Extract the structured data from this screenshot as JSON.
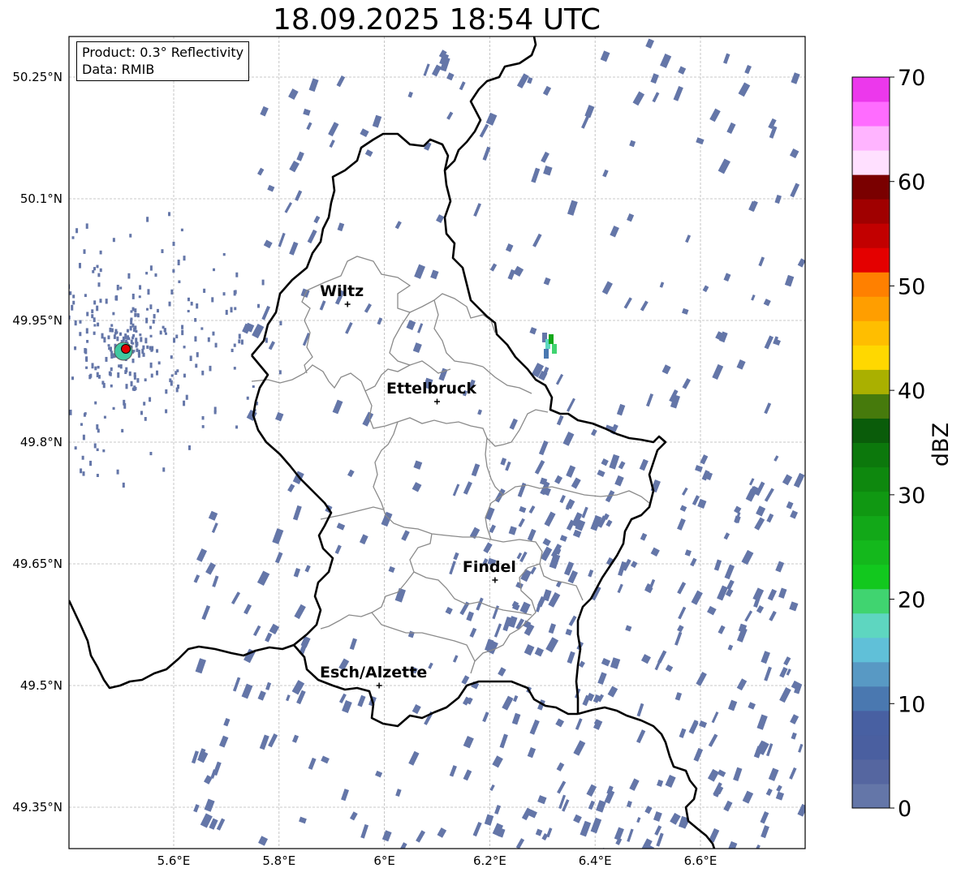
{
  "title": "18.09.2025 18:54 UTC",
  "infobox": {
    "product": "Product: 0.3° Reflectivity",
    "data": "Data: RMIB"
  },
  "map": {
    "lon_range": [
      5.4,
      6.8
    ],
    "lat_range": [
      49.3,
      50.3
    ],
    "lon_ticks": [
      "5.6°E",
      "5.8°E",
      "6°E",
      "6.2°E",
      "6.4°E",
      "6.6°E"
    ],
    "lat_ticks": [
      "50.25°N",
      "50.1°N",
      "49.95°N",
      "49.8°N",
      "49.65°N",
      "49.5°N",
      "49.35°N"
    ],
    "grid": true,
    "cities": [
      {
        "name": "Wiltz",
        "lon": 5.93,
        "lat": 49.97
      },
      {
        "name": "Ettelbruck",
        "lon": 6.1,
        "lat": 49.85
      },
      {
        "name": "Findel",
        "lon": 6.21,
        "lat": 49.63
      },
      {
        "name": "Esch/Alzette",
        "lon": 5.99,
        "lat": 49.5
      }
    ],
    "radar_site": {
      "lon": 5.505,
      "lat": 49.915
    }
  },
  "colorbar": {
    "label": "dBZ",
    "tick_labels": [
      "0",
      "10",
      "20",
      "30",
      "40",
      "50",
      "60",
      "70"
    ],
    "min": 0,
    "max": 70,
    "colors": [
      "#6476a8",
      "#5566a0",
      "#4a5fa0",
      "#4860a2",
      "#4a78b0",
      "#5899c4",
      "#60c0d8",
      "#5ed6c0",
      "#40d470",
      "#12c81e",
      "#14b81c",
      "#12a818",
      "#109812",
      "#0e880e",
      "#0c780c",
      "#0a5c0a",
      "#467a0c",
      "#aab000",
      "#ffd800",
      "#ffbe00",
      "#ff9e00",
      "#ff8000",
      "#e40000",
      "#c20000",
      "#a00000",
      "#7a0000",
      "#ffe0ff",
      "#ffb4ff",
      "#ff6cff",
      "#ec38ec"
    ]
  }
}
